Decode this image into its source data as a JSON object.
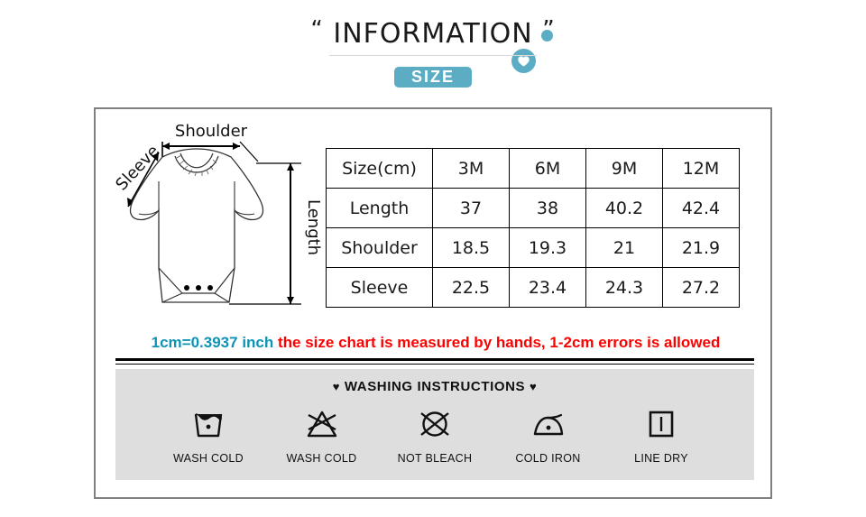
{
  "header": {
    "title_open_quote": "“",
    "title_text": "INFORMATION",
    "title_close_quote": "”",
    "size_badge_label": "SIZE",
    "accent_color": "#5cadc4"
  },
  "garment_diagram": {
    "shoulder_label": "Shoulder",
    "sleeve_label": "Sleeve",
    "length_label": "Length"
  },
  "size_table": {
    "columns": [
      "Size(cm)",
      "3M",
      "6M",
      "9M",
      "12M"
    ],
    "rows": [
      {
        "label": "Length",
        "values": [
          "37",
          "38",
          "40.2",
          "42.4"
        ]
      },
      {
        "label": "Shoulder",
        "values": [
          "18.5",
          "19.3",
          "21",
          "21.9"
        ]
      },
      {
        "label": "Sleeve",
        "values": [
          "22.5",
          "23.4",
          "24.3",
          "27.2"
        ]
      }
    ]
  },
  "note": {
    "conversion": "1cm=0.3937 inch",
    "conversion_color": "#0d93b5",
    "disclaimer": " the size chart is measured by hands, 1-2cm errors is allowed",
    "disclaimer_color": "#ff0000"
  },
  "washing": {
    "heading_heart_left": "♥",
    "heading": "WASHING INSTRUCTIONS",
    "heading_heart_right": "♥",
    "panel_color": "#dedede",
    "items": [
      {
        "icon": "wash-tub-icon",
        "label": "WASH COLD"
      },
      {
        "icon": "no-bleach-triangle-icon",
        "label": "WASH COLD"
      },
      {
        "icon": "no-dryclean-circle-icon",
        "label": "NOT BLEACH"
      },
      {
        "icon": "iron-one-dot-icon",
        "label": "COLD IRON"
      },
      {
        "icon": "line-dry-square-icon",
        "label": "LINE DRY"
      }
    ]
  }
}
